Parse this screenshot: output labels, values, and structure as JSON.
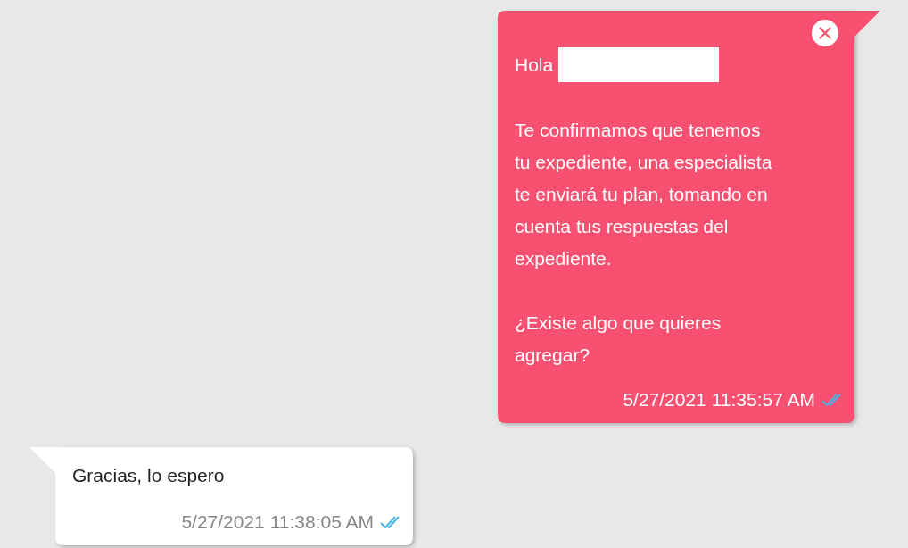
{
  "messages": [
    {
      "kind": "outgoing",
      "closable": true,
      "greeting": "Hola",
      "paragraphs": [
        "Te confirmamos que tenemos\ntu expediente, una especialista\nte enviará tu plan, tomando en\ncuenta tus respuestas del\nexpediente.",
        "¿Existe algo que quieres\nagregar?"
      ],
      "timestamp": "5/27/2021 11:35:57 AM",
      "read": true
    },
    {
      "kind": "incoming",
      "paragraphs": [
        "Gracias, lo espero"
      ],
      "timestamp": "5/27/2021 11:38:05 AM",
      "read": true
    }
  ]
}
